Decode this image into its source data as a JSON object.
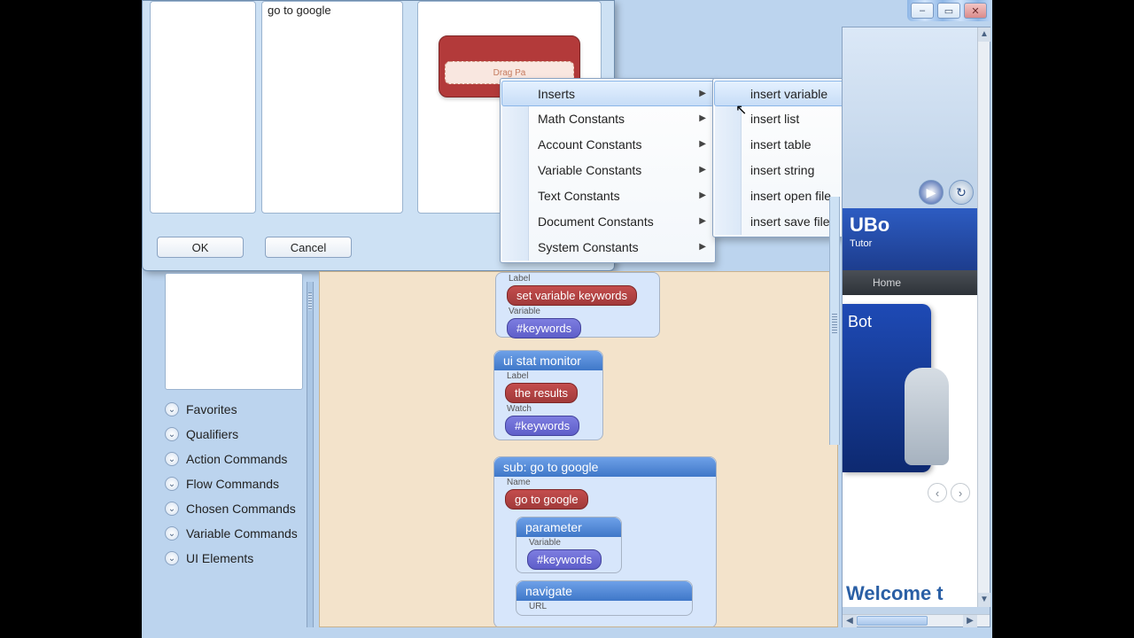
{
  "window": {
    "minimize": "–",
    "maximize": "▭",
    "close": "✕"
  },
  "dialog": {
    "list_item": "go to google",
    "drag_hint": "Drag Pa",
    "ok": "OK",
    "cancel": "Cancel"
  },
  "context_menu": {
    "items": [
      "Inserts",
      "Math Constants",
      "Account Constants",
      "Variable Constants",
      "Text Constants",
      "Document Constants",
      "System Constants"
    ],
    "submenu": [
      "insert variable",
      "insert list",
      "insert table",
      "insert string",
      "insert open file",
      "insert save file"
    ]
  },
  "categories": [
    "Favorites",
    "Qualifiers",
    "Action Commands",
    "Flow Commands",
    "Chosen Commands",
    "Variable Commands",
    "UI Elements"
  ],
  "script": {
    "n1": {
      "field": "Label",
      "pill": "set variable keywords",
      "field2": "Variable",
      "pill2": "#keywords"
    },
    "n2": {
      "hdr": "ui stat monitor",
      "field": "Label",
      "pill": "the results",
      "field2": "Watch",
      "pill2": "#keywords"
    },
    "n3": {
      "hdr": "sub: go to google",
      "field": "Name",
      "pill": "go to google",
      "inner1": {
        "hdr": "parameter",
        "field": "Variable",
        "pill": "#keywords"
      },
      "inner2": {
        "hdr": "navigate",
        "field": "URL"
      }
    }
  },
  "browser": {
    "brand": "UBo",
    "brand_sub": "Tutor",
    "nav_home": "Home",
    "box_label": "Bot",
    "welcome": "Welcome t",
    "prev": "‹",
    "next": "›"
  }
}
